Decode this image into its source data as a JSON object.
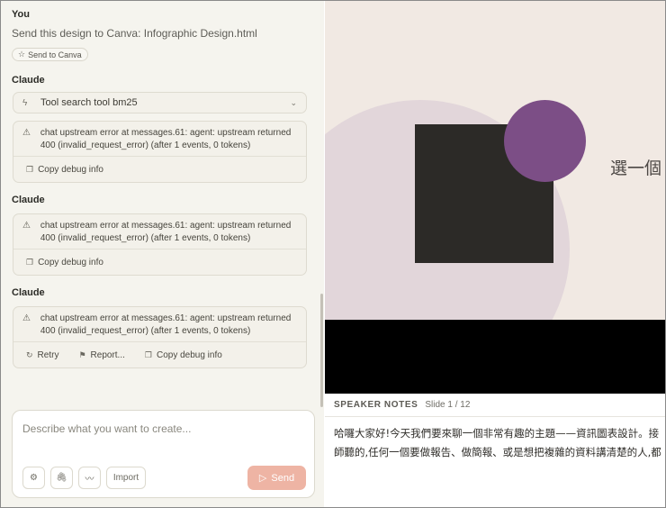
{
  "chat": {
    "user_speaker": "You",
    "user_message": "Send this design to Canva: Infographic Design.html",
    "send_chip": {
      "icon": "star-icon",
      "label": "Send to Canva"
    },
    "assistant_speaker": "Claude",
    "tool_row": {
      "icon": "lightning-icon",
      "label": "Tool search tool bm25"
    },
    "blocks": [
      {
        "speaker": "Claude",
        "error": "chat upstream error at messages.61: agent: upstream returned 400 (invalid_request_error) (after 1 events, 0 tokens)",
        "copy_label": "Copy debug info"
      },
      {
        "speaker": "Claude",
        "error": "chat upstream error at messages.61: agent: upstream returned 400 (invalid_request_error) (after 1 events, 0 tokens)",
        "copy_label": "Copy debug info"
      },
      {
        "speaker": "Claude",
        "error": "chat upstream error at messages.61: agent: upstream returned 400 (invalid_request_error) (after 1 events, 0 tokens)",
        "retry_label": "Retry",
        "report_label": "Report...",
        "copy_label": "Copy debug info"
      }
    ]
  },
  "composer": {
    "placeholder": "Describe what you want to create...",
    "import_label": "Import",
    "send_label": "Send",
    "send_color": "#eeb4a4"
  },
  "preview": {
    "slide_text": "選一個",
    "colors": {
      "background": "#f1e9e3",
      "circle": "#e2d6da",
      "square": "#2c2a27",
      "accent": "#7c4e86"
    },
    "notes": {
      "title": "SPEAKER NOTES",
      "counter": "Slide 1 / 12",
      "line1": "哈囉大家好!今天我們要來聊一個非常有趣的主題——資訊圖表設計。接",
      "line2": "師聽的,任何一個要做報告、做簡報、或是想把複雜的資料講清楚的人,都"
    }
  }
}
